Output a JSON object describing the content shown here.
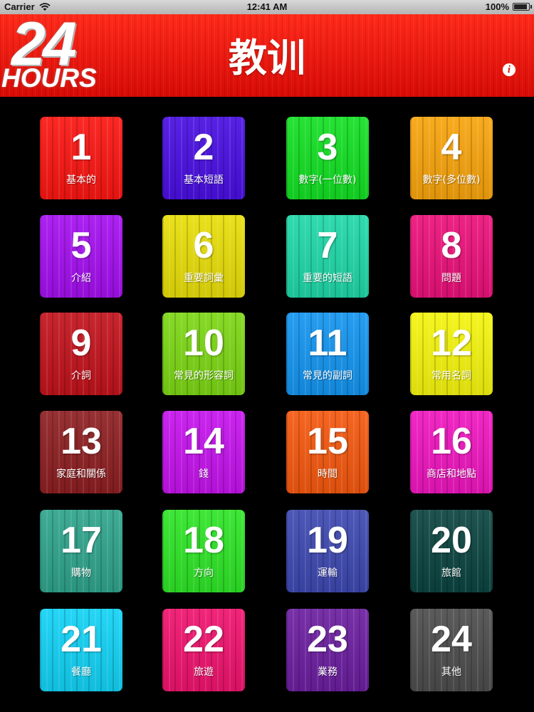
{
  "status_bar": {
    "carrier": "Carrier",
    "time": "12:41 AM",
    "battery": "100%",
    "battery_level": 1.0
  },
  "header": {
    "logo_number": "24",
    "logo_word": "HOURS",
    "title": "教训",
    "info_icon": "info-icon"
  },
  "lessons": [
    {
      "number": "1",
      "label": "基本的",
      "color": "#fb1612"
    },
    {
      "number": "2",
      "label": "基本短語",
      "color": "#4a0fe3"
    },
    {
      "number": "3",
      "label": "數字(一位數)",
      "color": "#13e023"
    },
    {
      "number": "4",
      "label": "數字(多位數)",
      "color": "#f8a40c"
    },
    {
      "number": "5",
      "label": "介紹",
      "color": "#a50ff0"
    },
    {
      "number": "6",
      "label": "重要詞彙",
      "color": "#e8de08"
    },
    {
      "number": "7",
      "label": "重要的短語",
      "color": "#1fd8a8"
    },
    {
      "number": "8",
      "label": "問題",
      "color": "#ec117a"
    },
    {
      "number": "9",
      "label": "介詞",
      "color": "#c3131c"
    },
    {
      "number": "10",
      "label": "常見的形容詞",
      "color": "#7cd714"
    },
    {
      "number": "11",
      "label": "常見的副詞",
      "color": "#1495f0"
    },
    {
      "number": "12",
      "label": "常用名詞",
      "color": "#f4f50c"
    },
    {
      "number": "13",
      "label": "家庭和關係",
      "color": "#8e1f22"
    },
    {
      "number": "14",
      "label": "錢",
      "color": "#c613ee"
    },
    {
      "number": "15",
      "label": "時間",
      "color": "#f5580f"
    },
    {
      "number": "16",
      "label": "商店和地點",
      "color": "#f016c0"
    },
    {
      "number": "17",
      "label": "購物",
      "color": "#2fa48c"
    },
    {
      "number": "18",
      "label": "方向",
      "color": "#2ee526"
    },
    {
      "number": "19",
      "label": "運輸",
      "color": "#3e49b1"
    },
    {
      "number": "20",
      "label": "旅館",
      "color": "#0c4541"
    },
    {
      "number": "21",
      "label": "餐廳",
      "color": "#12d2f5"
    },
    {
      "number": "22",
      "label": "旅遊",
      "color": "#f0136e"
    },
    {
      "number": "23",
      "label": "業務",
      "color": "#6c1fa0"
    },
    {
      "number": "24",
      "label": "其他",
      "color": "#4d4d4d"
    }
  ]
}
